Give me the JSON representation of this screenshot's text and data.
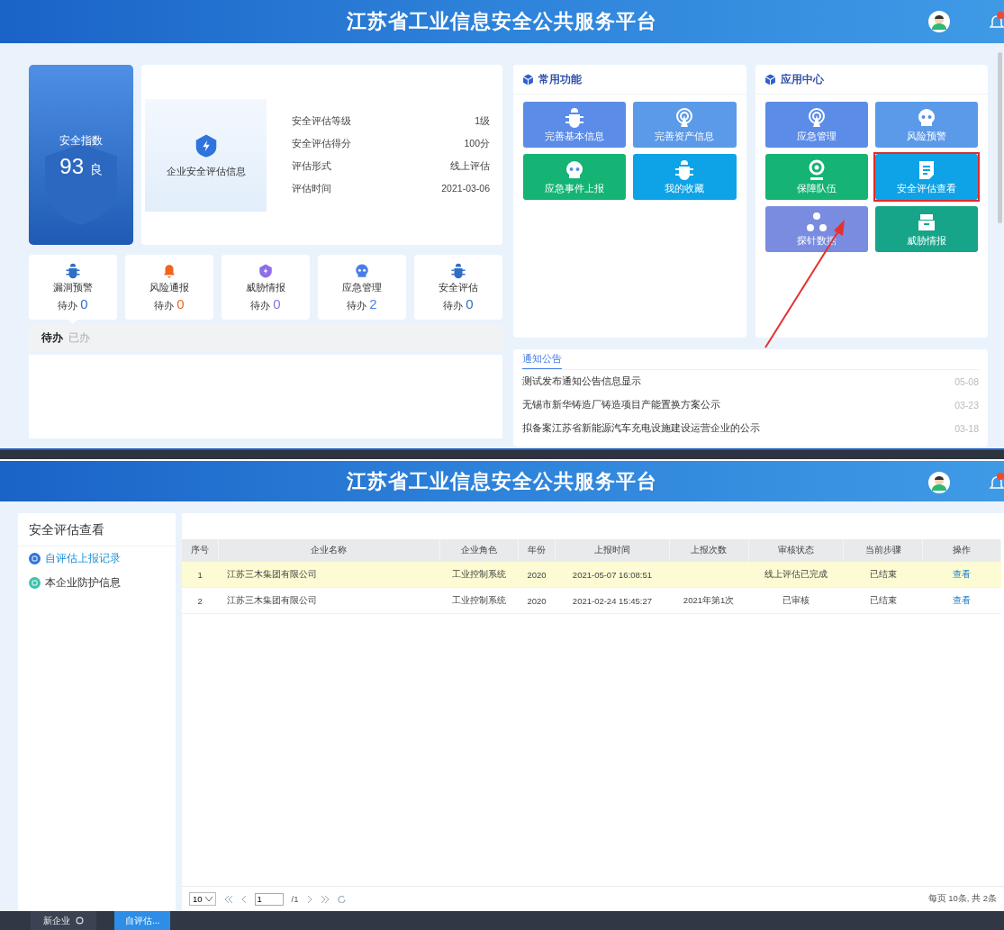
{
  "top": {
    "header": {
      "title": "江苏省工业信息安全公共服务平台"
    },
    "score": {
      "label": "安全指数",
      "value": "93",
      "grade": "良"
    },
    "assessment": {
      "title": "企业安全评估信息",
      "fields": [
        {
          "label": "安全评估等级",
          "value": "1级"
        },
        {
          "label": "安全评估得分",
          "value": "100分"
        },
        {
          "label": "评估形式",
          "value": "线上评估"
        },
        {
          "label": "评估时间",
          "value": "2021-03-06"
        }
      ]
    },
    "todo_tiles": [
      {
        "label": "漏洞预警",
        "prefix": "待办",
        "count": "0",
        "color": "#2f6fc4",
        "selected": true
      },
      {
        "label": "风险通报",
        "prefix": "待办",
        "count": "0",
        "color": "#f0641e",
        "selected": false
      },
      {
        "label": "威胁情报",
        "prefix": "待办",
        "count": "0",
        "color": "#8e6ee8",
        "selected": false
      },
      {
        "label": "应急管理",
        "prefix": "待办",
        "count": "2",
        "color": "#4a7ee6",
        "selected": false
      },
      {
        "label": "安全评估",
        "prefix": "待办",
        "count": "0",
        "color": "#2f6fc4",
        "selected": false
      }
    ],
    "todo_tabs": [
      {
        "label": "待办",
        "selected": true
      },
      {
        "label": "已办",
        "selected": false
      }
    ],
    "common_functions": {
      "title": "常用功能",
      "tiles": [
        {
          "label": "完善基本信息",
          "color": "#5b8ce8",
          "highlighted": false
        },
        {
          "label": "完善资产信息",
          "color": "#5b9ae8",
          "highlighted": false
        },
        {
          "label": "应急事件上报",
          "color": "#15b374",
          "highlighted": false
        },
        {
          "label": "我的收藏",
          "color": "#0ea3e6",
          "highlighted": false
        }
      ]
    },
    "app_center": {
      "title": "应用中心",
      "tiles": [
        {
          "label": "应急管理",
          "color": "#5b8ce8",
          "highlighted": false
        },
        {
          "label": "风险预警",
          "color": "#5b9ae8",
          "highlighted": false
        },
        {
          "label": "保障队伍",
          "color": "#15b374",
          "highlighted": false
        },
        {
          "label": "安全评估查看",
          "color": "#0ea3e6",
          "highlighted": true
        },
        {
          "label": "探针数据",
          "color": "#7a8ce0",
          "highlighted": false
        },
        {
          "label": "威胁情报",
          "color": "#17a58a",
          "highlighted": false
        }
      ]
    },
    "annotation_arrow": true,
    "notices": {
      "title": "通知公告",
      "items": [
        {
          "text": "测试发布通知公告信息显示",
          "date": "05-08"
        },
        {
          "text": "无锡市新华铸造厂铸造项目产能置换方案公示",
          "date": "03-23"
        },
        {
          "text": "拟备案江苏省新能源汽车充电设施建设运营企业的公示",
          "date": "03-18"
        }
      ]
    }
  },
  "bottom": {
    "header": {
      "title": "江苏省工业信息安全公共服务平台"
    },
    "sidebar": {
      "title": "安全评估查看",
      "items": [
        {
          "label": "自评估上报记录",
          "selected": true
        },
        {
          "label": "本企业防护信息",
          "selected": false
        }
      ]
    },
    "table": {
      "columns": [
        "序号",
        "企业名称",
        "企业角色",
        "年份",
        "上报时间",
        "上报次数",
        "审核状态",
        "当前步骤",
        "操作"
      ],
      "rows": [
        {
          "cells": [
            "1",
            "江苏三木集团有限公司",
            "工业控制系统",
            "2020",
            "2021-05-07 16:08:51",
            "",
            "线上评估已完成",
            "已结束",
            "查看"
          ],
          "selected": true
        },
        {
          "cells": [
            "2",
            "江苏三木集团有限公司",
            "工业控制系统",
            "2020",
            "2021-02-24 15:45:27",
            "2021年第1次",
            "已审核",
            "已结束",
            "查看"
          ],
          "selected": false
        }
      ]
    },
    "pagination": {
      "page_size": "10",
      "page": "1",
      "total_pages": "/1",
      "summary": "每页 10条, 共 2条"
    },
    "taskbar": {
      "items": [
        {
          "label": "新企业",
          "kind": "tab"
        },
        {
          "label": "自评估...",
          "kind": "button"
        }
      ]
    }
  }
}
